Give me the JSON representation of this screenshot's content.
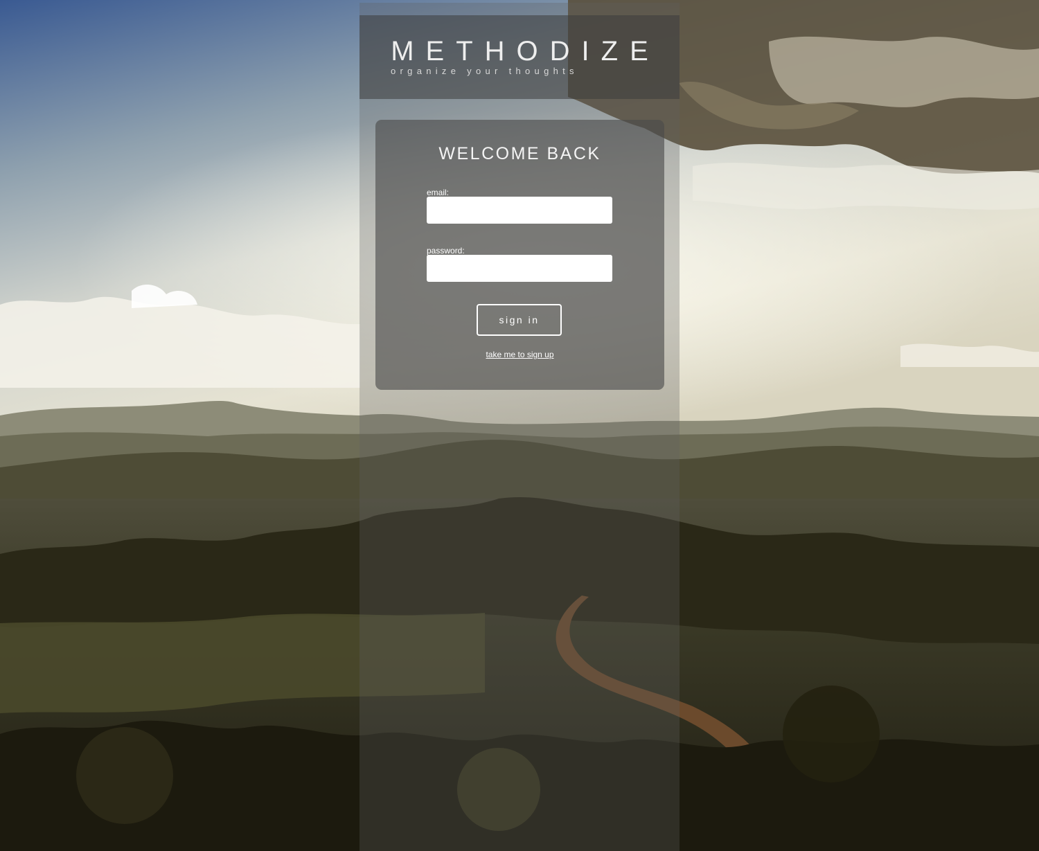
{
  "brand": {
    "title": "METHODIZE",
    "tagline": "organize your thoughts"
  },
  "login": {
    "heading": "WELCOME BACK",
    "email_label": "email:",
    "email_value": "",
    "password_label": "password:",
    "password_value": "",
    "signin_label": "sign in",
    "signup_link": "take me to sign up"
  },
  "background": {
    "scene": "landscape-photo",
    "sky_color": "#4a6490",
    "cloud_color": "#e8e6dc",
    "hill_color": "#5f5c45",
    "forest_color": "#2f2c1b"
  }
}
